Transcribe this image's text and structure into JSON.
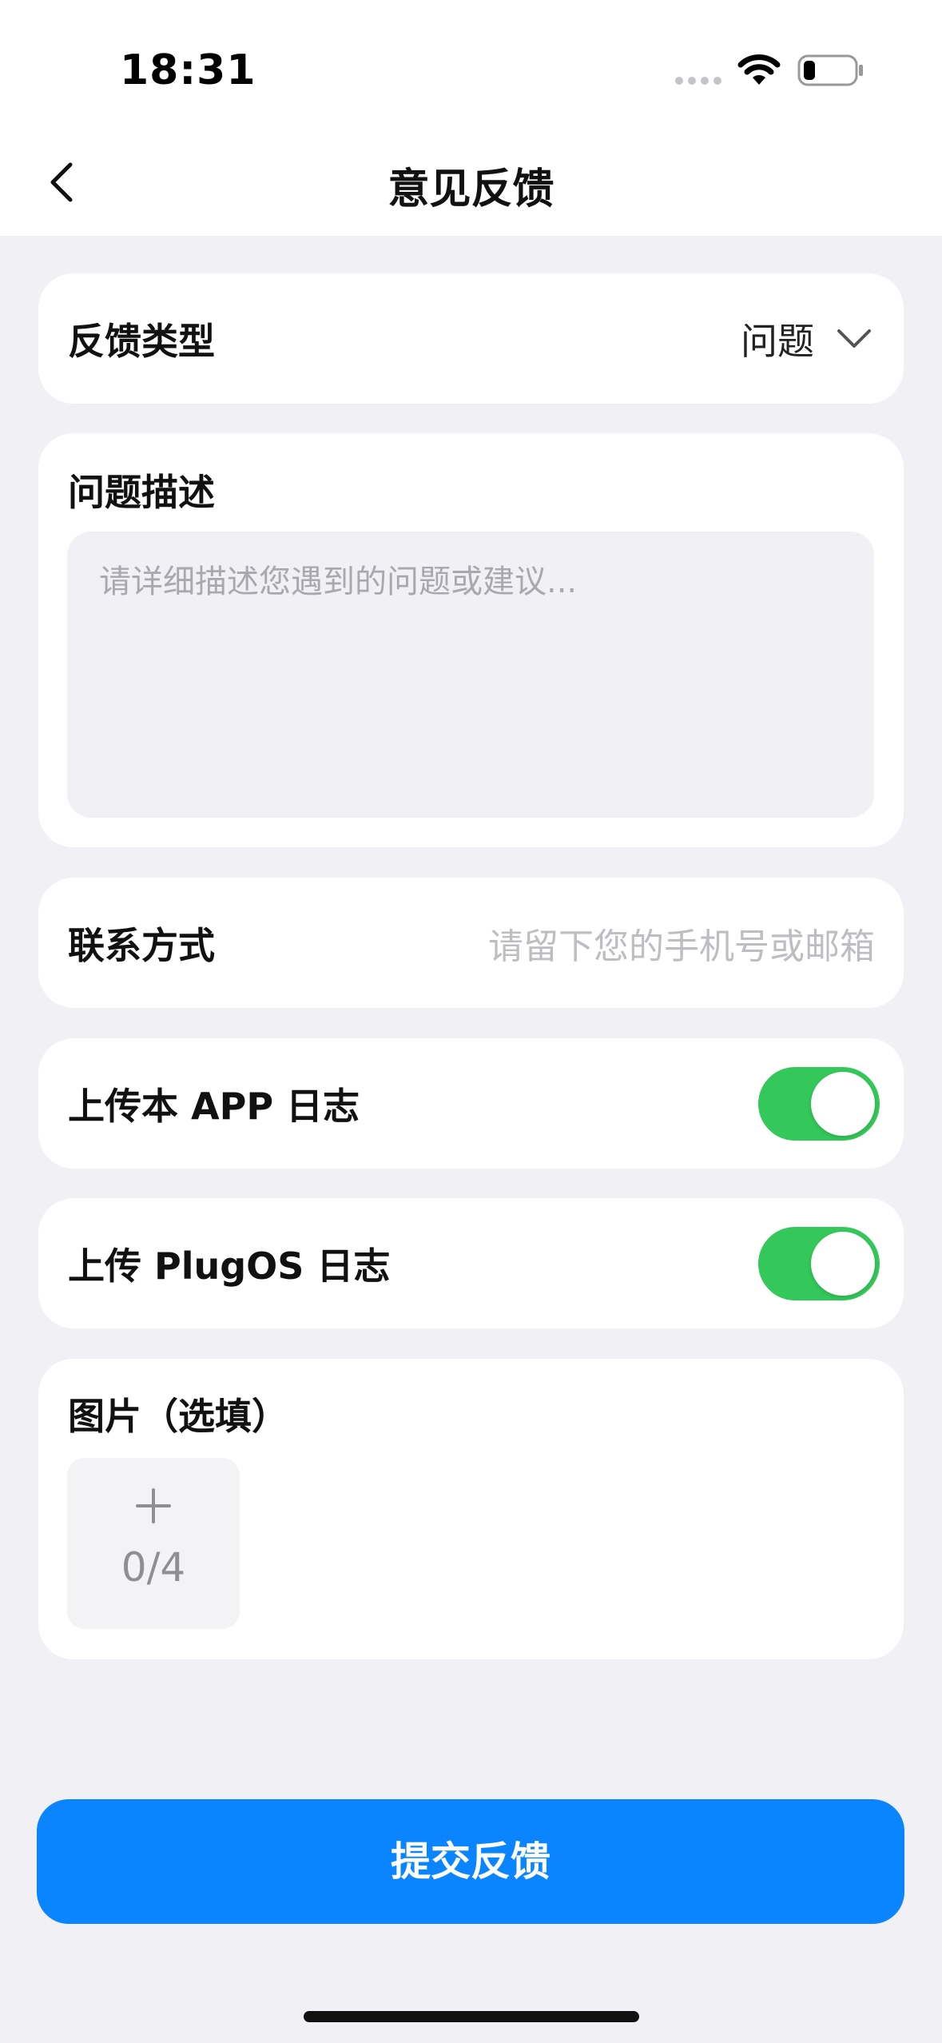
{
  "status_bar": {
    "time": "18:31"
  },
  "nav": {
    "title": "意见反馈"
  },
  "feedback_type": {
    "label": "反馈类型",
    "value": "问题"
  },
  "description": {
    "label": "问题描述",
    "placeholder": "请详细描述您遇到的问题或建议..."
  },
  "contact": {
    "label": "联系方式",
    "placeholder": "请留下您的手机号或邮箱"
  },
  "upload_app_log": {
    "label": "上传本 APP 日志",
    "enabled": true
  },
  "upload_plugos_log": {
    "label": "上传 PlugOS 日志",
    "enabled": true
  },
  "images": {
    "label": "图片（选填）",
    "count": "0/4"
  },
  "submit": {
    "label": "提交反馈"
  },
  "colors": {
    "accent": "#0A84FF",
    "toggle_on": "#34C759",
    "background": "#F0F0F5"
  }
}
